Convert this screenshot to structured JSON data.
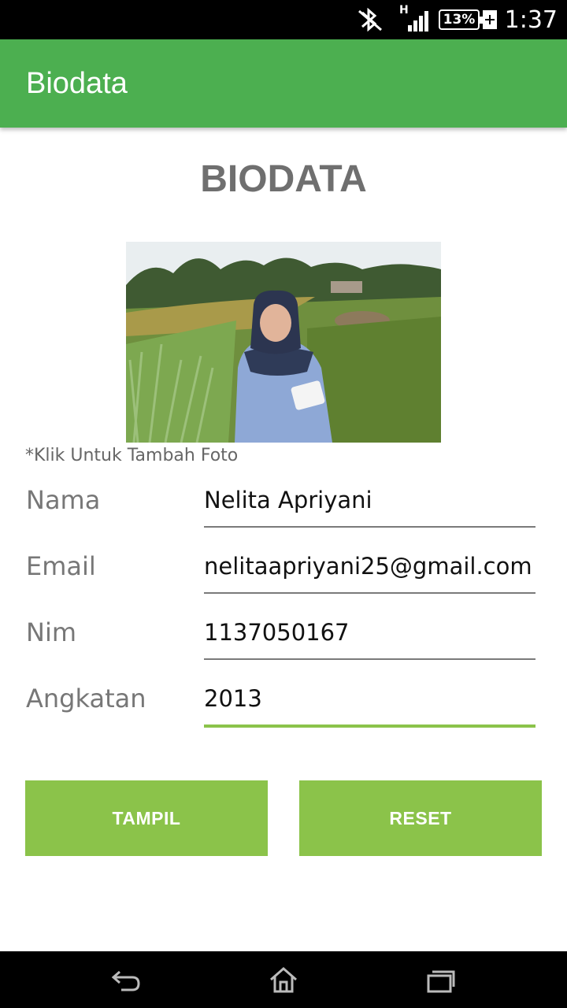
{
  "status_bar": {
    "time": "1:37",
    "battery": "13%",
    "network": "H",
    "icons": [
      "bluetooth-off-icon",
      "signal-icon",
      "battery-icon",
      "charging-icon"
    ]
  },
  "app_bar": {
    "title": "Biodata"
  },
  "heading": "BIODATA",
  "photo": {
    "hint": "*Klik Untuk Tambah Foto"
  },
  "form": [
    {
      "label": "Nama",
      "value": "Nelita Apriyani"
    },
    {
      "label": "Email",
      "value": "nelitaapriyani25@gmail.com"
    },
    {
      "label": "Nim",
      "value": "1137050167"
    },
    {
      "label": "Angkatan",
      "value": "2013"
    }
  ],
  "buttons": {
    "show": "TAMPIL",
    "reset": "RESET"
  },
  "nav_bar": {
    "icons": [
      "back-icon",
      "home-icon",
      "recent-apps-icon"
    ]
  },
  "colors": {
    "app_bar": "#4caf50",
    "accent": "#8bc34a",
    "heading": "#6f6f6f"
  }
}
